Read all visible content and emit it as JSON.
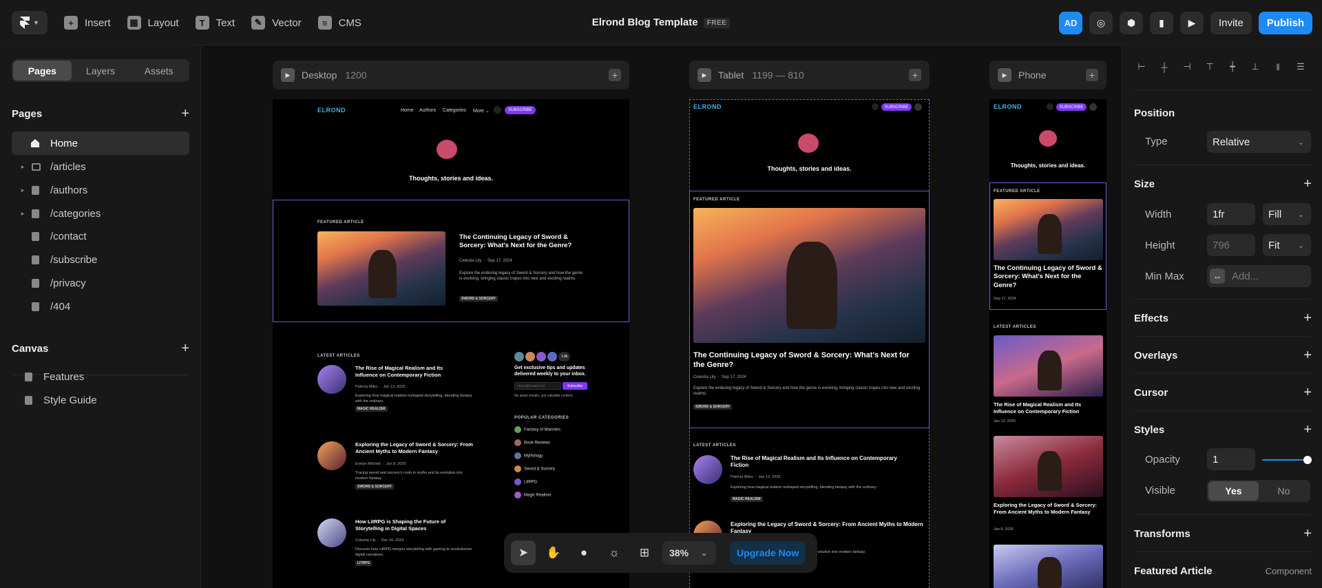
{
  "toolbar": {
    "insert": "Insert",
    "layout": "Layout",
    "text": "Text",
    "vector": "Vector",
    "cms": "CMS",
    "title": "Elrond Blog Template",
    "badge": "FREE",
    "avatar": "AD",
    "invite": "Invite",
    "publish": "Publish"
  },
  "left": {
    "tabs": [
      "Pages",
      "Layers",
      "Assets"
    ],
    "pages_heading": "Pages",
    "pages": [
      "Home",
      "/articles",
      "/authors",
      "/categories",
      "/contact",
      "/subscribe",
      "/privacy",
      "/404"
    ],
    "canvas_heading": "Canvas",
    "canvas_items": [
      "Features",
      "Style Guide"
    ]
  },
  "frames": {
    "desktop": {
      "name": "Desktop",
      "dim": "1200"
    },
    "tablet": {
      "name": "Tablet",
      "dim": "1199 — 810"
    },
    "phone": {
      "name": "Phone"
    }
  },
  "site": {
    "logo": "ELROND",
    "nav": [
      "Home",
      "Authors",
      "Categories",
      "More ⌄"
    ],
    "subscribe": "SUBSCRIBE",
    "subscribe_btn": "Subscribe",
    "hero": "Thoughts, stories and ideas.",
    "featured_label": "FEATURED ARTICLE",
    "featured_title": "The Continuing Legacy of Sword & Sorcery: What's Next for the Genre?",
    "featured_author": "Celestia Lily",
    "featured_date": "Sep 17, 2024",
    "featured_desc": "Explore the enduring legacy of Sword & Sorcery and how the genre is evolving, bringing classic tropes into new and exciting realms.",
    "featured_tag": "SWORD & SORCERY",
    "latest_label": "LATEST ARTICLES",
    "articles": [
      {
        "title": "The Rise of Magical Realism and Its Influence on Contemporary Fiction",
        "author": "Patricia Miles",
        "date": "Jan 12, 2025",
        "desc": "Exploring how magical realism reshaped storytelling, blending fantasy with the ordinary.",
        "tag": "MAGIC REALISM"
      },
      {
        "title": "Exploring the Legacy of Sword & Sorcery: From Ancient Myths to Modern Fantasy",
        "author": "Evelyn Mitchell",
        "date": "Jan 8, 2025",
        "desc": "Tracing sword and sorcery's roots in myths and its evolution into modern fantasy.",
        "tag": "SWORD & SORCERY"
      },
      {
        "title": "How LitRPG is Shaping the Future of Storytelling in Digital Spaces",
        "author": "Celestia Lily",
        "date": "Dec 16, 2024",
        "desc": "Discover how LitRPG merges storytelling with gaming to revolutionize digital narratives.",
        "tag": "LITRPG"
      }
    ],
    "members": "1.8k",
    "newsletter_title": "Get exclusive tips and updates delivered weekly to your inbox.",
    "newsletter_placeholder": "name@email.com",
    "newsletter_note": "No spam emails, just valuable content.",
    "popular_label": "POPULAR CATEGORIES",
    "categories": [
      "Fantasy of Manners",
      "Book Reviews",
      "Mythology",
      "Sword & Sorcery",
      "LitRPG",
      "Magic Realism"
    ]
  },
  "bottombar": {
    "zoom": "38%",
    "upgrade": "Upgrade Now"
  },
  "right": {
    "position": "Position",
    "type_label": "Type",
    "type_value": "Relative",
    "size": "Size",
    "width_label": "Width",
    "width_value": "1fr",
    "width_mode": "Fill",
    "height_label": "Height",
    "height_placeholder": "796",
    "height_mode": "Fit",
    "minmax_label": "Min Max",
    "minmax_placeholder": "Add...",
    "effects": "Effects",
    "overlays": "Overlays",
    "cursor": "Cursor",
    "styles": "Styles",
    "opacity_label": "Opacity",
    "opacity_value": "1",
    "opacity_level": 1,
    "visible_label": "Visible",
    "visible_yes": "Yes",
    "visible_no": "No",
    "transforms": "Transforms",
    "featured": "Featured Article",
    "component": "Component"
  },
  "colors": {
    "accent": "#1e8af5",
    "purple": "#7c3aed",
    "selection": "#6b5bd6"
  }
}
